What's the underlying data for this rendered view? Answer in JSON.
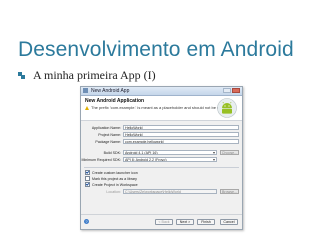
{
  "slide": {
    "title": "Desenvolvimento em Android",
    "bullet": "A minha primeira App (I)"
  },
  "dialog": {
    "window_title": "New Android App",
    "header_title": "New Android Application",
    "header_message": "The prefix 'com.example.' is meant as a placeholder and should not be used",
    "fields": {
      "app_name_label": "Application Name:",
      "app_name_value": "HelloWorld",
      "project_name_label": "Project Name:",
      "project_name_value": "HelloWorld",
      "package_name_label": "Package Name:",
      "package_name_value": "com.example.helloworld",
      "build_sdk_label": "Build SDK:",
      "build_sdk_value": "Android 4.1 (API 16)",
      "build_sdk_button": "Choose...",
      "min_sdk_label": "Minimum Required SDK:",
      "min_sdk_value": "API 8: Android 2.2 (Froyo)"
    },
    "options": {
      "custom_icon": "Create custom launcher icon",
      "library": "Mark this project as a library",
      "workspace": "Create Project in Workspace"
    },
    "location": {
      "label": "Location:",
      "value": "C:\\Users\\Ze\\workspace\\HelloWorld",
      "button": "Browse..."
    },
    "footer": {
      "help_glyph": "?",
      "back": "< Back",
      "next": "Next >",
      "finish": "Finish",
      "cancel": "Cancel"
    }
  },
  "colors": {
    "title": "#2c7a9c",
    "android_green": "#97c024"
  }
}
